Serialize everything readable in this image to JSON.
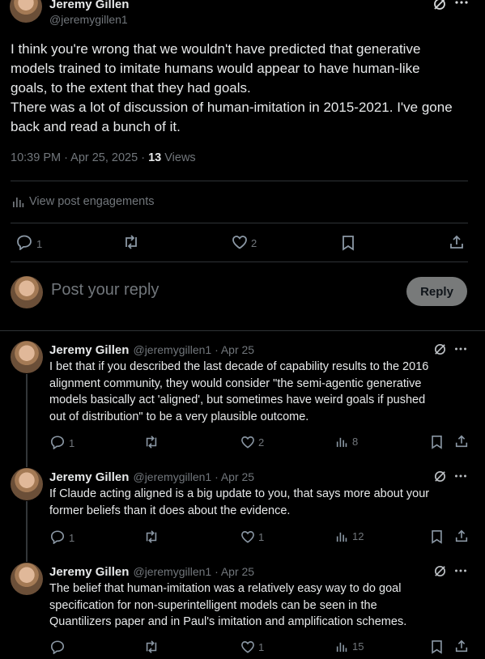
{
  "main_post": {
    "author": "Jeremy Gillen",
    "handle": "@jeremygillen1",
    "lines": [
      "I think you're wrong that we wouldn't have predicted that generative",
      "models trained to imitate humans would appear to have human-like",
      "goals, to the extent that they had goals.",
      "There was a lot of discussion of human-imitation in 2015-2021. I've gone",
      "back and read a bunch of it."
    ],
    "timestamp": "10:39 PM · Apr 25, 2025 · ",
    "views_count": "13",
    "views_label": " Views",
    "engagements_label": "View post engagements",
    "reply_count": "1",
    "repost_count": "",
    "like_count": "2"
  },
  "composer": {
    "placeholder": "Post your reply",
    "button": "Reply"
  },
  "replies": [
    {
      "author": "Jeremy Gillen",
      "handle": "@jeremygillen1 · Apr 25",
      "lines": [
        "I bet that if you described the last decade of capability results to the 2016",
        "alignment community, they would consider \"the semi-agentic generative",
        "models basically act 'aligned', but sometimes have weird goals if pushed",
        "out of distribution\" to be a very plausible outcome."
      ],
      "reply_count": "1",
      "like_count": "2",
      "views": "8"
    },
    {
      "author": "Jeremy Gillen",
      "handle": "@jeremygillen1 · Apr 25",
      "lines": [
        "If Claude acting aligned is a big update to you, that says more about your",
        "former beliefs than it does about the evidence."
      ],
      "reply_count": "1",
      "like_count": "1",
      "views": "12"
    },
    {
      "author": "Jeremy Gillen",
      "handle": "@jeremygillen1 · Apr 25",
      "lines": [
        "The belief that human-imitation was a relatively easy way to do goal",
        "specification for non-superintelligent models can be seen in the",
        "Quantilizers paper and in Paul's imitation and amplification schemes."
      ],
      "reply_count": "",
      "like_count": "1",
      "views": "15"
    }
  ],
  "icons": {
    "reply": "reply-icon",
    "repost": "repost-icon",
    "like": "like-icon",
    "views": "views-icon",
    "bookmark": "bookmark-icon",
    "share": "share-icon",
    "grok": "grok-icon",
    "more": "more-icon"
  }
}
